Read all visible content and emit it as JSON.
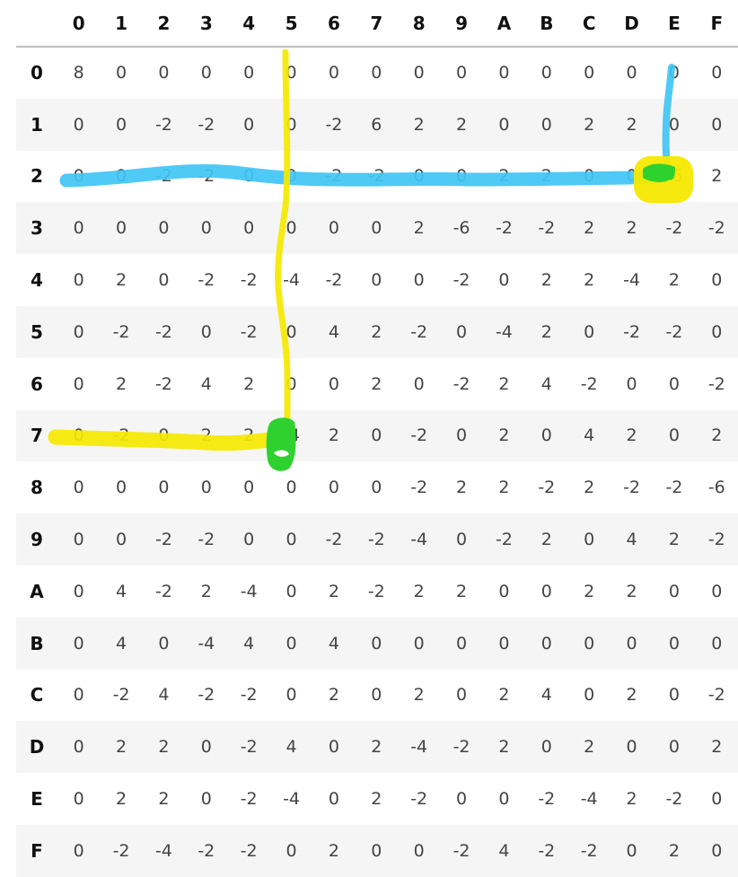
{
  "table": {
    "corner": "",
    "columns": [
      "0",
      "1",
      "2",
      "3",
      "4",
      "5",
      "6",
      "7",
      "8",
      "9",
      "A",
      "B",
      "C",
      "D",
      "E",
      "F"
    ],
    "rows": [
      {
        "label": "0",
        "cells": [
          "8",
          "0",
          "0",
          "0",
          "0",
          "0",
          "0",
          "0",
          "0",
          "0",
          "0",
          "0",
          "0",
          "0",
          "0",
          "0"
        ]
      },
      {
        "label": "1",
        "cells": [
          "0",
          "0",
          "-2",
          "-2",
          "0",
          "0",
          "-2",
          "6",
          "2",
          "2",
          "0",
          "0",
          "2",
          "2",
          "0",
          "0"
        ]
      },
      {
        "label": "2",
        "cells": [
          "0",
          "0",
          "-2",
          "-2",
          "0",
          "0",
          "-2",
          "-2",
          "0",
          "0",
          "2",
          "2",
          "0",
          "0",
          "-6",
          "2"
        ]
      },
      {
        "label": "3",
        "cells": [
          "0",
          "0",
          "0",
          "0",
          "0",
          "0",
          "0",
          "0",
          "2",
          "-6",
          "-2",
          "-2",
          "2",
          "2",
          "-2",
          "-2"
        ]
      },
      {
        "label": "4",
        "cells": [
          "0",
          "2",
          "0",
          "-2",
          "-2",
          "-4",
          "-2",
          "0",
          "0",
          "-2",
          "0",
          "2",
          "2",
          "-4",
          "2",
          "0"
        ]
      },
      {
        "label": "5",
        "cells": [
          "0",
          "-2",
          "-2",
          "0",
          "-2",
          "0",
          "4",
          "2",
          "-2",
          "0",
          "-4",
          "2",
          "0",
          "-2",
          "-2",
          "0"
        ]
      },
      {
        "label": "6",
        "cells": [
          "0",
          "2",
          "-2",
          "4",
          "2",
          "0",
          "0",
          "2",
          "0",
          "-2",
          "2",
          "4",
          "-2",
          "0",
          "0",
          "-2"
        ]
      },
      {
        "label": "7",
        "cells": [
          "0",
          "-2",
          "0",
          "2",
          "2",
          "-4",
          "2",
          "0",
          "-2",
          "0",
          "2",
          "0",
          "4",
          "2",
          "0",
          "2"
        ]
      },
      {
        "label": "8",
        "cells": [
          "0",
          "0",
          "0",
          "0",
          "0",
          "0",
          "0",
          "0",
          "-2",
          "2",
          "2",
          "-2",
          "2",
          "-2",
          "-2",
          "-6"
        ]
      },
      {
        "label": "9",
        "cells": [
          "0",
          "0",
          "-2",
          "-2",
          "0",
          "0",
          "-2",
          "-2",
          "-4",
          "0",
          "-2",
          "2",
          "0",
          "4",
          "2",
          "-2"
        ]
      },
      {
        "label": "A",
        "cells": [
          "0",
          "4",
          "-2",
          "2",
          "-4",
          "0",
          "2",
          "-2",
          "2",
          "2",
          "0",
          "0",
          "2",
          "2",
          "0",
          "0"
        ]
      },
      {
        "label": "B",
        "cells": [
          "0",
          "4",
          "0",
          "-4",
          "4",
          "0",
          "4",
          "0",
          "0",
          "0",
          "0",
          "0",
          "0",
          "0",
          "0",
          "0"
        ]
      },
      {
        "label": "C",
        "cells": [
          "0",
          "-2",
          "4",
          "-2",
          "-2",
          "0",
          "2",
          "0",
          "2",
          "0",
          "2",
          "4",
          "0",
          "2",
          "0",
          "-2"
        ]
      },
      {
        "label": "D",
        "cells": [
          "0",
          "2",
          "2",
          "0",
          "-2",
          "4",
          "0",
          "2",
          "-4",
          "-2",
          "2",
          "0",
          "2",
          "0",
          "0",
          "2"
        ]
      },
      {
        "label": "E",
        "cells": [
          "0",
          "2",
          "2",
          "0",
          "-2",
          "-4",
          "0",
          "2",
          "-2",
          "0",
          "0",
          "-2",
          "-4",
          "2",
          "-2",
          "0"
        ]
      },
      {
        "label": "F",
        "cells": [
          "0",
          "-2",
          "-4",
          "-2",
          "-2",
          "0",
          "2",
          "0",
          "0",
          "-2",
          "4",
          "-2",
          "-2",
          "0",
          "2",
          "0"
        ]
      }
    ]
  },
  "annotations": {
    "colors": {
      "blue": "#40c4f5",
      "yellow": "#f5e800",
      "green": "#2ed12e"
    }
  }
}
